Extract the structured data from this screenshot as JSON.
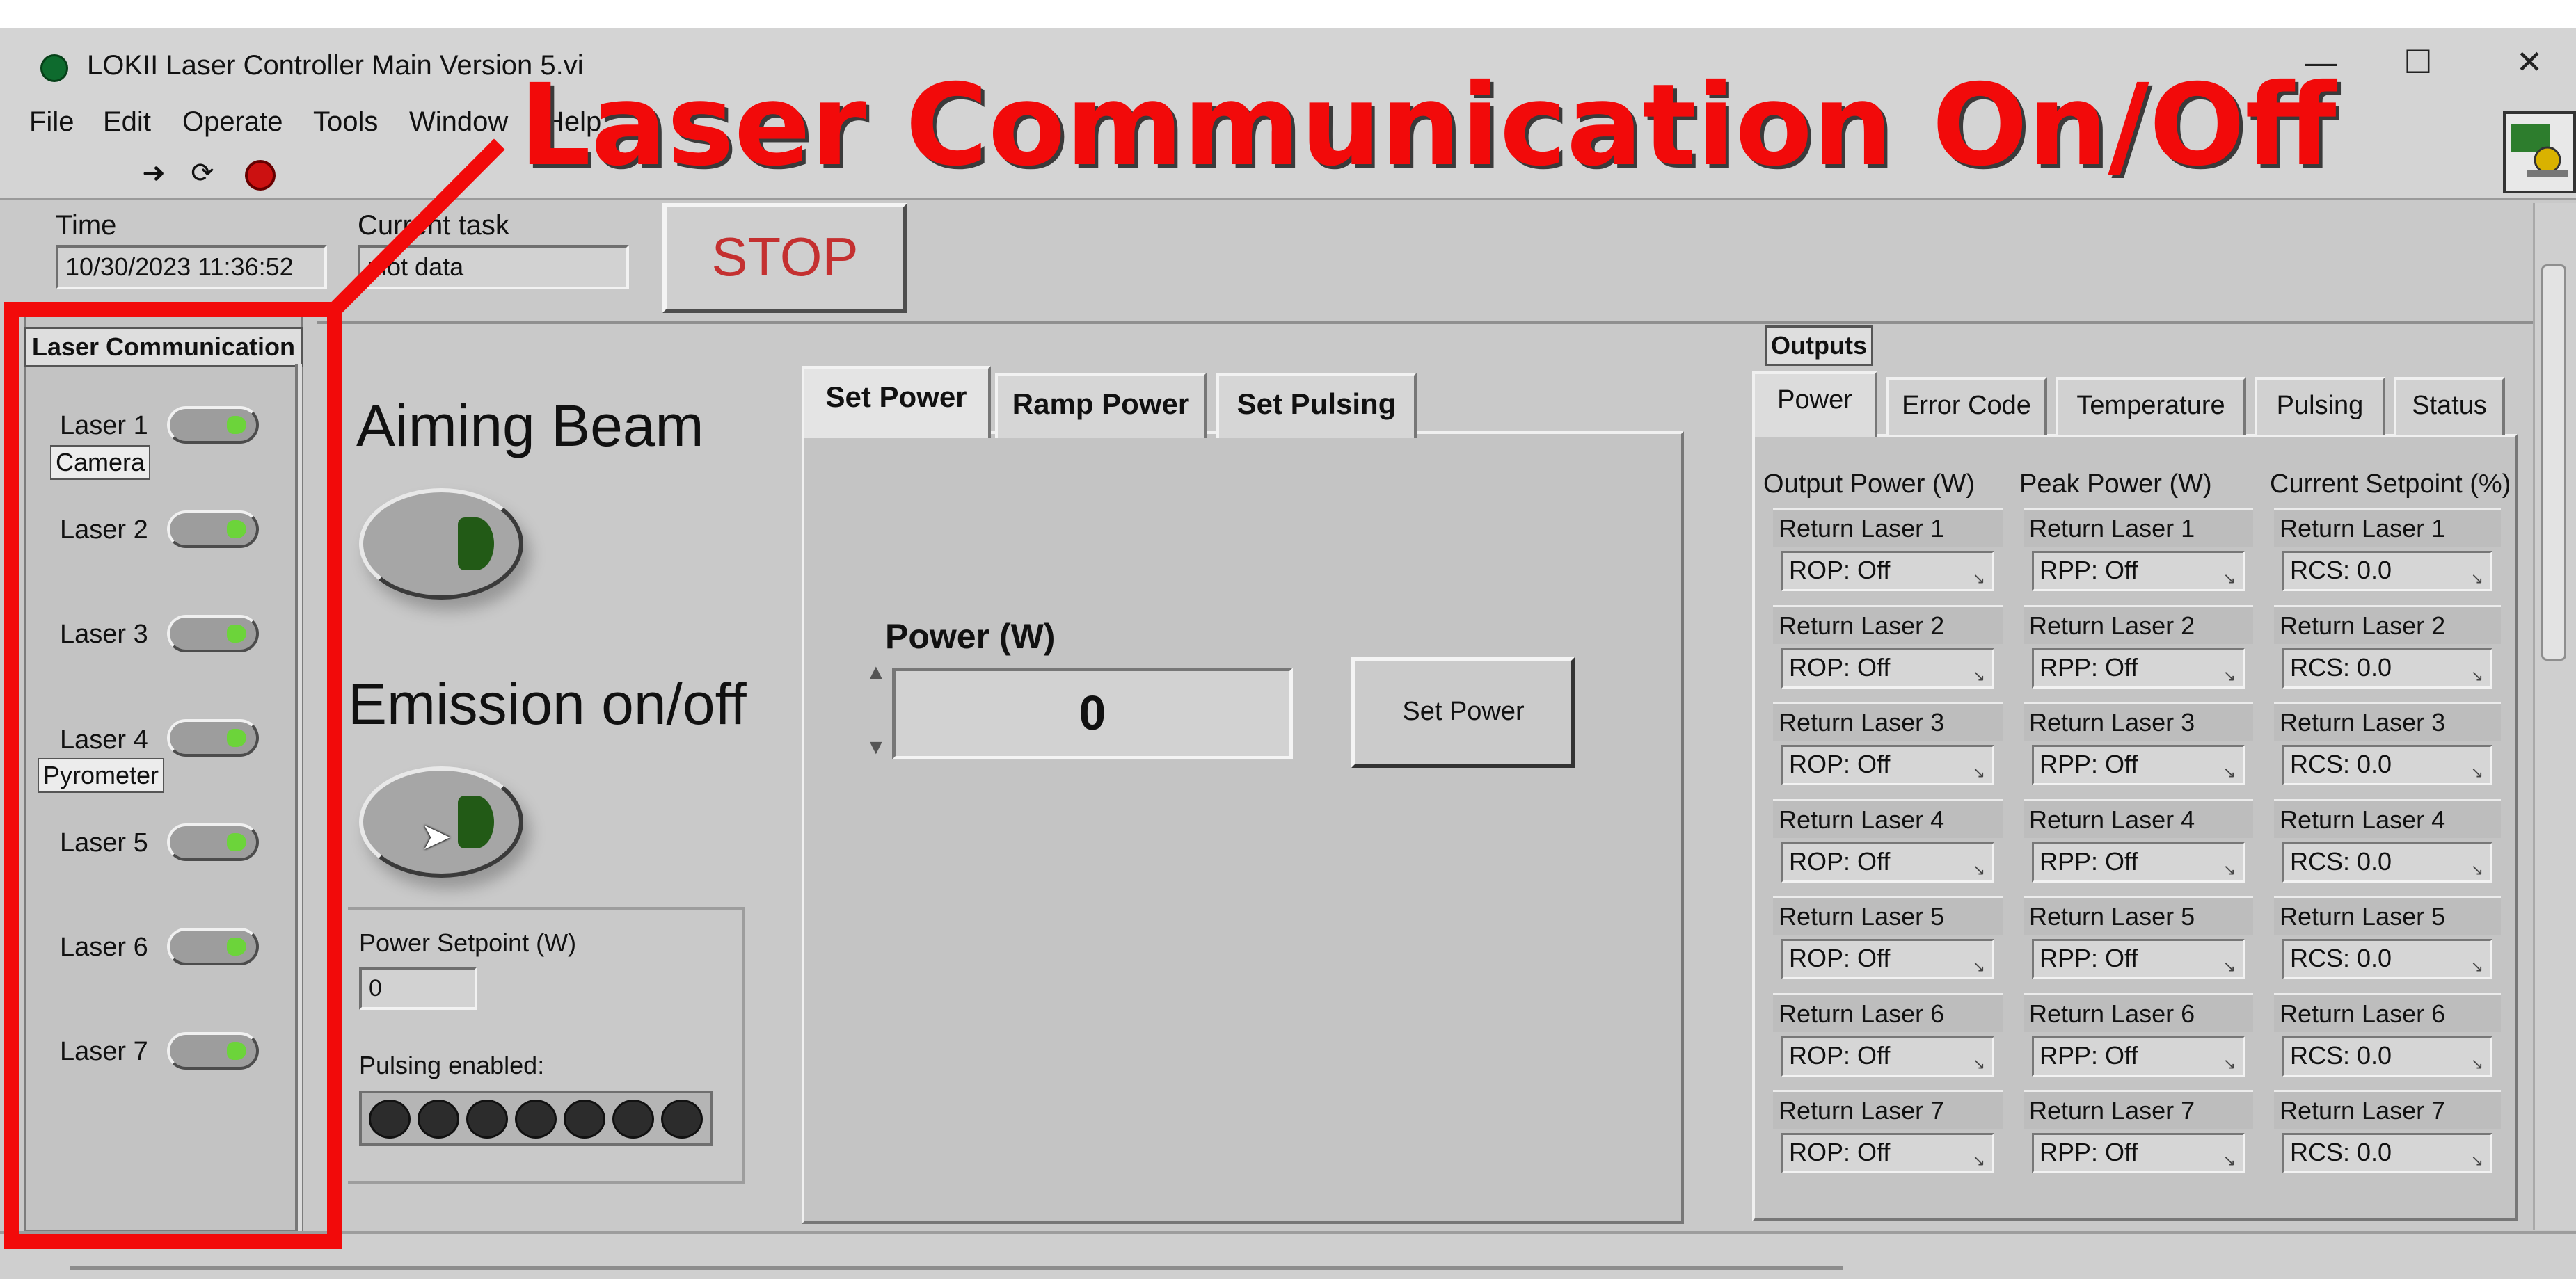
{
  "window": {
    "title": "LOKII Laser Controller Main Version 5.vi",
    "controls": {
      "minimize": "—",
      "maximize": "☐",
      "close": "✕"
    }
  },
  "menu": [
    "File",
    "Edit",
    "Operate",
    "Tools",
    "Window",
    "Help"
  ],
  "toolbar": {
    "icons": [
      "run-arrow-icon",
      "run-continuously-icon",
      "abort-execution-icon"
    ],
    "run_glyph": "➜",
    "continuous_glyph": "⟳"
  },
  "status": {
    "time_label": "Time",
    "time_value": "10/30/2023 11:36:52",
    "task_label": "Current task",
    "task_value": "plot data",
    "stop_label": "STOP"
  },
  "laser_communication": {
    "title": "Laser Communication",
    "lasers": [
      {
        "label": "Laser 1",
        "on": true
      },
      {
        "label": "Laser 2",
        "on": true
      },
      {
        "label": "Laser 3",
        "on": true
      },
      {
        "label": "Laser 4",
        "on": true
      },
      {
        "label": "Laser 5",
        "on": true
      },
      {
        "label": "Laser 6",
        "on": true
      },
      {
        "label": "Laser 7",
        "on": true
      }
    ],
    "notes": {
      "camera": "Camera",
      "pyrometer": "Pyrometer"
    }
  },
  "controls": {
    "aiming_beam": "Aiming Beam",
    "emission": "Emission on/off",
    "power_setpoint_label": "Power Setpoint (W)",
    "power_setpoint_value": "0",
    "pulsing_label": "Pulsing enabled:",
    "pulsing_led_count": 7
  },
  "center_tabs": {
    "tabs": [
      "Set Power",
      "Ramp Power",
      "Set Pulsing"
    ],
    "active": "Set Power",
    "power_label": "Power (W)",
    "power_value": "0",
    "set_power_button": "Set Power"
  },
  "outputs": {
    "title": "Outputs",
    "tabs": [
      "Power",
      "Error Code",
      "Temperature",
      "Pulsing",
      "Status"
    ],
    "active_tab": "Power",
    "columns": [
      "Output Power (W)",
      "Peak Power (W)",
      "Current Setpoint (%)"
    ],
    "rows": [
      {
        "label": "Return Laser 1",
        "values": [
          "ROP: Off",
          "RPP: Off",
          "RCS: 0.0"
        ]
      },
      {
        "label": "Return Laser 2",
        "values": [
          "ROP: Off",
          "RPP: Off",
          "RCS: 0.0"
        ]
      },
      {
        "label": "Return Laser 3",
        "values": [
          "ROP: Off",
          "RPP: Off",
          "RCS: 0.0"
        ]
      },
      {
        "label": "Return Laser 4",
        "values": [
          "ROP: Off",
          "RPP: Off",
          "RCS: 0.0"
        ]
      },
      {
        "label": "Return Laser 5",
        "values": [
          "ROP: Off",
          "RPP: Off",
          "RCS: 0.0"
        ]
      },
      {
        "label": "Return Laser 6",
        "values": [
          "ROP: Off",
          "RPP: Off",
          "RCS: 0.0"
        ]
      },
      {
        "label": "Return Laser 7",
        "values": [
          "ROP: Off",
          "RPP: Off",
          "RCS: 0.0"
        ]
      }
    ]
  },
  "annotation": {
    "title": "Laser Communication On/Off",
    "color": "#f20a0a"
  }
}
